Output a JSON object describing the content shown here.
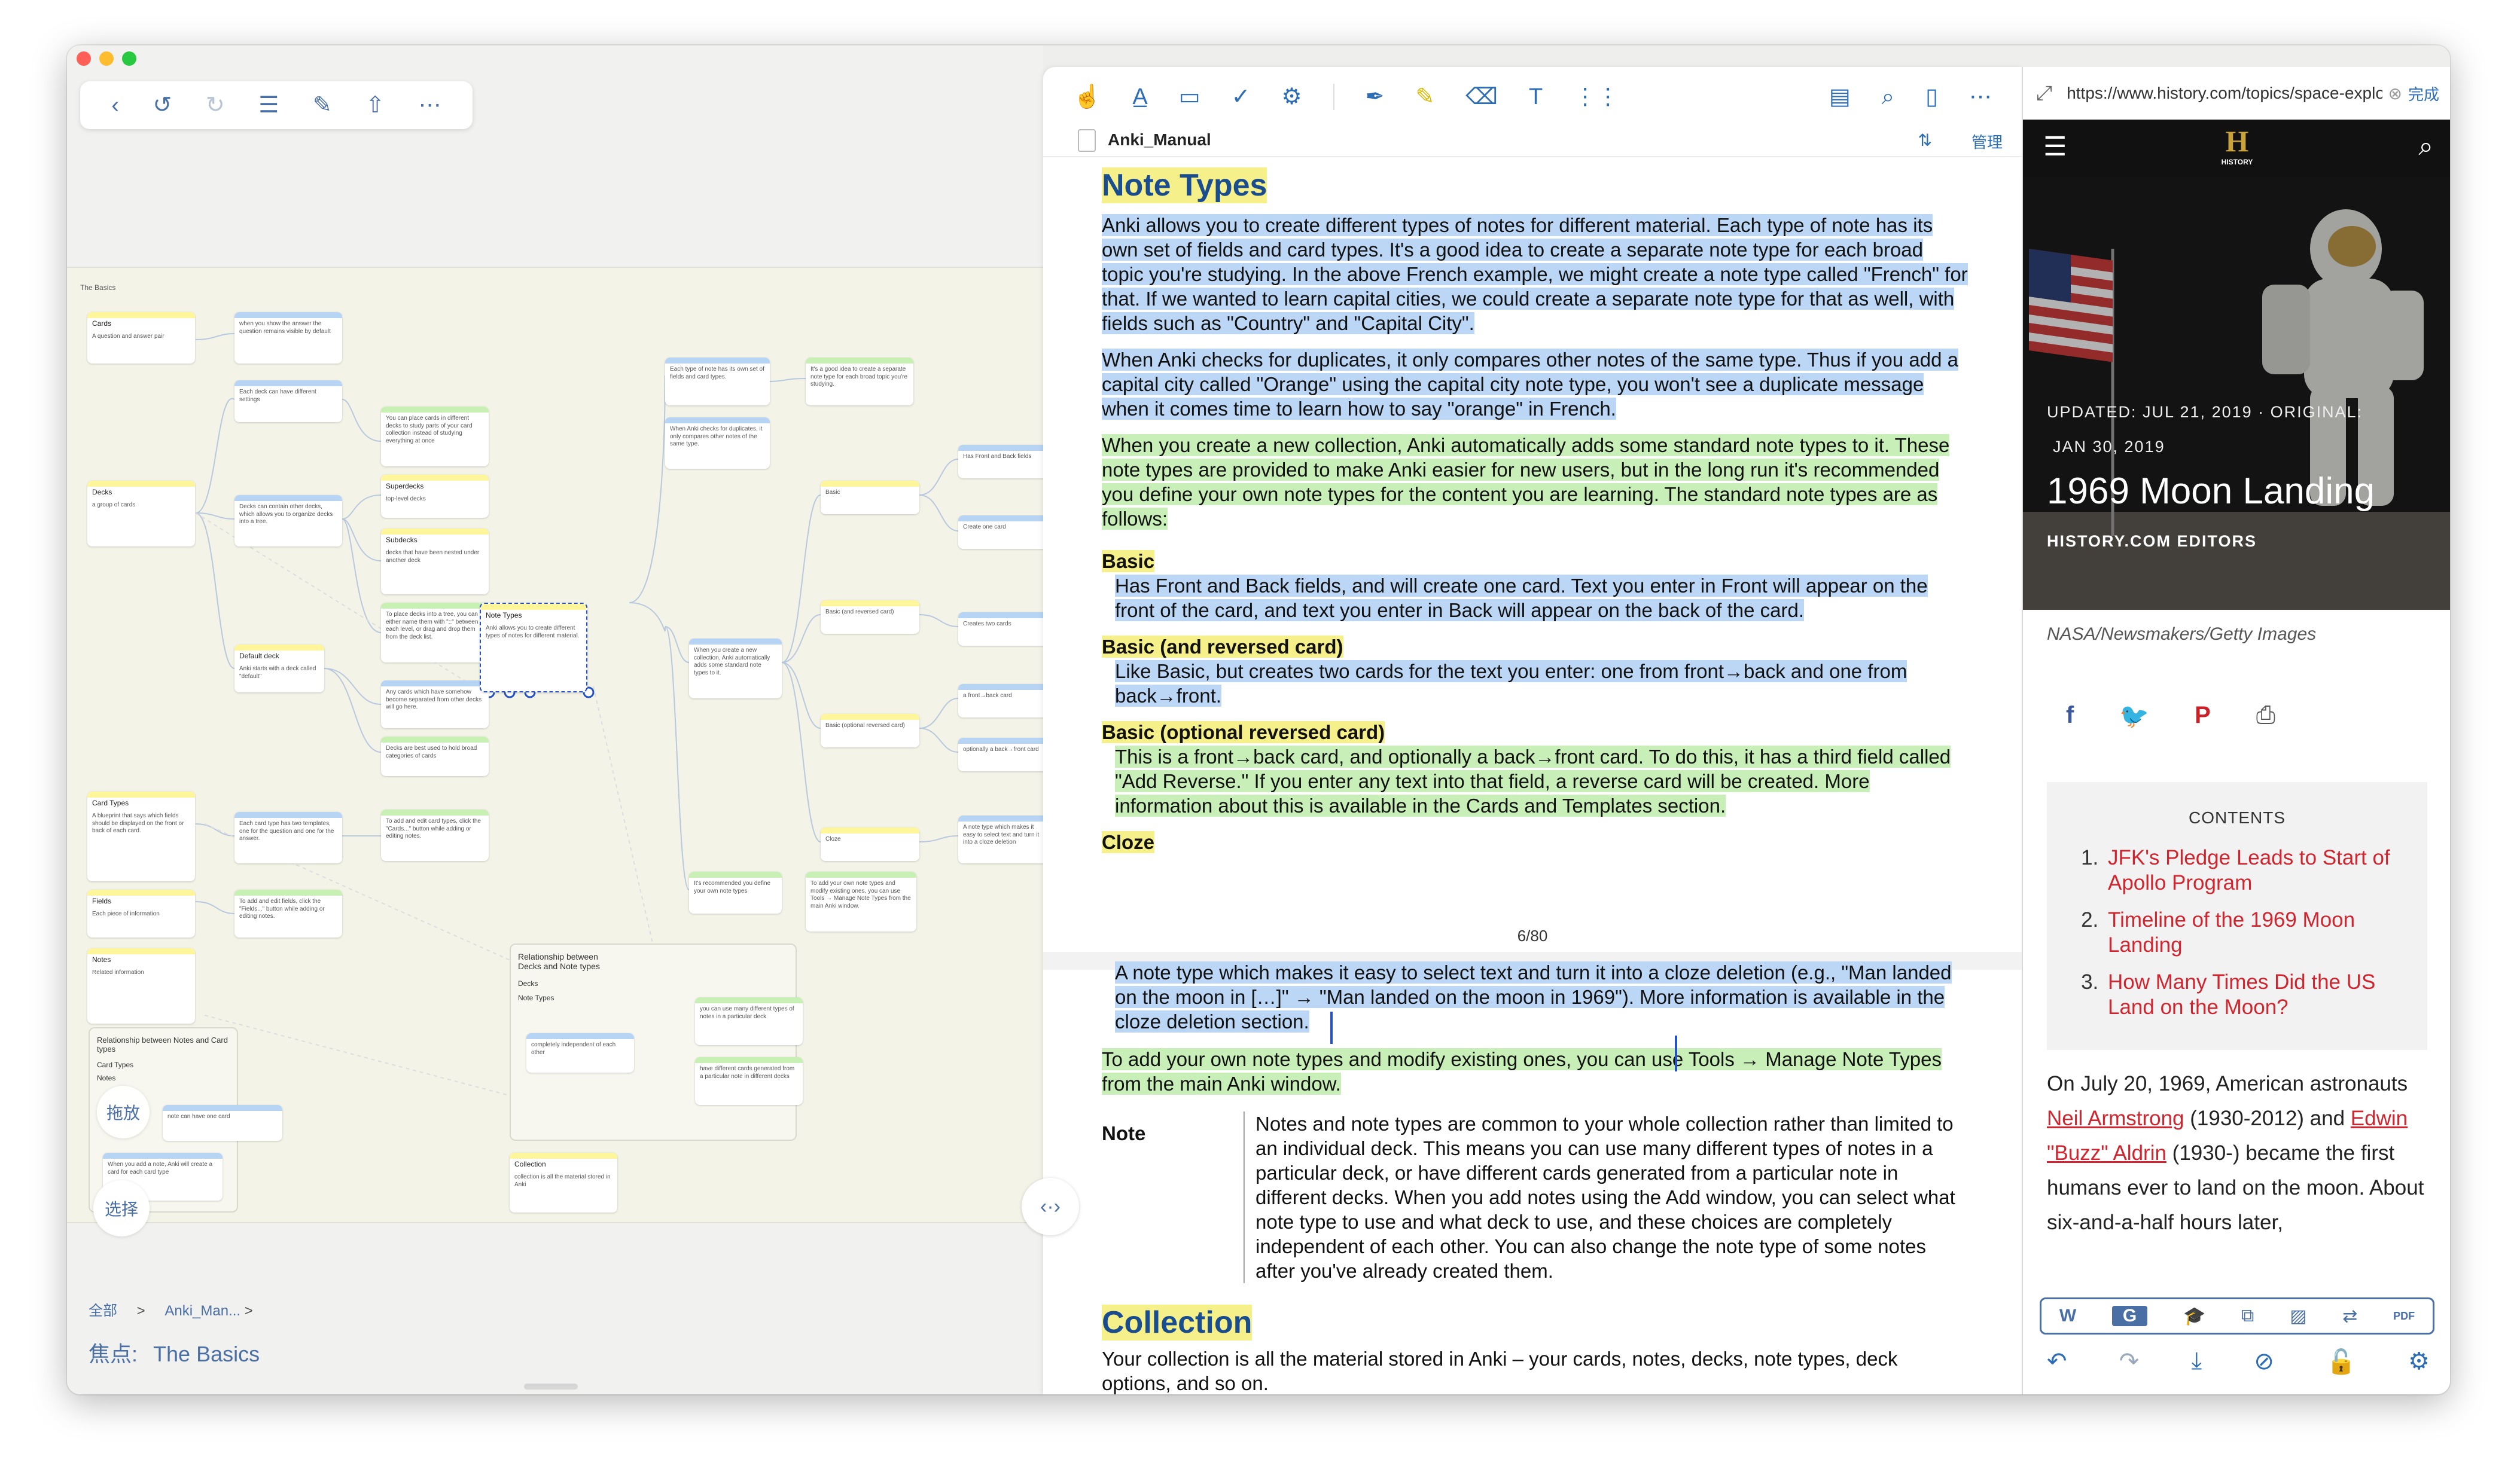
{
  "window": {
    "traffic": [
      "#ff5f57",
      "#febc2e",
      "#28c840"
    ]
  },
  "mindmap": {
    "toolbar": [
      "‹",
      "↺",
      "↻",
      "☰",
      "✎",
      "⇧",
      "⋯"
    ],
    "canvas_title": "The Basics",
    "nodes": [
      {
        "id": "cards",
        "title": "Cards",
        "text": "A question and answer pair"
      },
      {
        "id": "c1",
        "title": "",
        "text": "when you show the answer the question remains visible by default"
      },
      {
        "id": "c2",
        "title": "",
        "text": "Each deck can have different settings"
      },
      {
        "id": "c3",
        "title": "",
        "text": "You can place cards in different decks to study parts of your card collection instead of studying everything at once"
      },
      {
        "id": "superdecks",
        "title": "Superdecks",
        "text": "top-level decks"
      },
      {
        "id": "subdecks",
        "title": "Subdecks",
        "text": "decks that have been nested under another deck"
      },
      {
        "id": "decks",
        "title": "Decks",
        "text": "a group of cards"
      },
      {
        "id": "c4",
        "title": "",
        "text": "Decks can contain other decks, which allows you to organize decks into a tree."
      },
      {
        "id": "c5",
        "title": "",
        "text": "To place decks into a tree, you can either name them with \"::\" between each level, or drag and drop them from the deck list."
      },
      {
        "id": "defaultdeck",
        "title": "Default deck",
        "text": "Anki starts with a deck called \"default\""
      },
      {
        "id": "c6",
        "title": "",
        "text": "Any cards which have somehow become separated from other decks will go here."
      },
      {
        "id": "c7",
        "title": "",
        "text": "Decks are best used to hold broad categories of cards"
      },
      {
        "id": "notetypes",
        "title": "Note Types",
        "text": "Anki allows you to create different types of notes for different material."
      },
      {
        "id": "cardtypes",
        "title": "Card Types",
        "text": "A blueprint that says which fields should be displayed on the front or back of each card."
      },
      {
        "id": "c8",
        "title": "",
        "text": "Each card type has two templates, one for the question and one for the answer."
      },
      {
        "id": "c9",
        "title": "",
        "text": "To add and edit card types, click the \"Cards...\" button while adding or editing notes."
      },
      {
        "id": "fields",
        "title": "Fields",
        "text": "Each piece of information"
      },
      {
        "id": "c10",
        "title": "",
        "text": "To add and edit fields, click the \"Fields...\" button while adding or editing notes."
      },
      {
        "id": "notes",
        "title": "Notes",
        "text": "Related information"
      },
      {
        "id": "c11",
        "title": "",
        "text": "Each type of note has its own set of fields and card types."
      },
      {
        "id": "c12",
        "title": "",
        "text": "It's a good idea to create a separate note type for each broad topic you're studying."
      },
      {
        "id": "c13",
        "title": "",
        "text": "When Anki checks for duplicates, it only compares other notes of the same type."
      },
      {
        "id": "c14",
        "title": "",
        "text": "When you create a new collection, Anki automatically adds some standard note types to it."
      },
      {
        "id": "basic",
        "title": "",
        "text": "Basic"
      },
      {
        "id": "basicrev",
        "title": "",
        "text": "Basic (and reversed card)"
      },
      {
        "id": "basicopt",
        "title": "",
        "text": "Basic (optional reversed card)"
      },
      {
        "id": "cloze",
        "title": "",
        "text": "Cloze"
      },
      {
        "id": "c15",
        "title": "",
        "text": "Has Front and Back fields"
      },
      {
        "id": "c16",
        "title": "",
        "text": "Create one card"
      },
      {
        "id": "c17",
        "title": "",
        "text": "Creates two cards"
      },
      {
        "id": "c18",
        "title": "",
        "text": "a front→back card"
      },
      {
        "id": "c19",
        "title": "",
        "text": "optionally a back→front card"
      },
      {
        "id": "c20",
        "title": "",
        "text": "A note type which makes it easy to select text and turn it into a cloze deletion"
      },
      {
        "id": "c21",
        "title": "",
        "text": "It's recommended you define your own note types"
      },
      {
        "id": "c22",
        "title": "",
        "text": "To add your own note types and modify existing ones, you can use Tools → Manage Note Types from the main Anki window."
      },
      {
        "id": "c23",
        "title": "",
        "text": "you can use many different types of notes in a particular deck"
      },
      {
        "id": "c24",
        "title": "",
        "text": "completely independent of each other"
      },
      {
        "id": "c25",
        "title": "",
        "text": "have different cards generated from a particular note in different decks"
      },
      {
        "id": "collection",
        "title": "Collection",
        "text": "collection is all the material stored in Anki"
      },
      {
        "id": "c26",
        "title": "",
        "text": "note can have one card"
      },
      {
        "id": "c27",
        "title": "",
        "text": "When you add a note, Anki will create a card for each card type"
      }
    ],
    "rel1": {
      "title": "Relationship between Decks and Note types",
      "items": [
        "Decks",
        "Note Types"
      ]
    },
    "rel2": {
      "title": "Relationship between Notes and Card types",
      "items": [
        "Card Types",
        "Notes"
      ]
    },
    "drag_label": "拖放",
    "select_label": "选择",
    "breadcrumb": {
      "root": "全部",
      "sep": ">",
      "current": "Anki_Man..."
    },
    "focus_label": "焦点:",
    "focus_value": "The Basics"
  },
  "splitter_label": "‹·›",
  "pdf": {
    "toolbar": [
      "☝",
      "A̲",
      "▭",
      "✓",
      "⚙",
      "✒",
      "✎",
      "⌫",
      "T",
      "⋮⋮"
    ],
    "toolbar_right": [
      "▤",
      "⌕",
      "▯",
      "⋯"
    ],
    "doc_title": "Anki_Manual",
    "doc_sort_icon": "⇅",
    "manage_label": "管理",
    "page1": {
      "heading": "Note Types",
      "p1": "Anki allows you to create different types of notes for different material. Each type of note has its own set of fields and card types. It's a good idea to create a separate note type for each broad topic you're studying. In the above French example, we might create a note type called \"French\" for that. If we wanted to learn capital cities, we could create a separate note type for that as well, with fields such as \"Country\" and \"Capital City\".",
      "p2": "When Anki checks for duplicates, it only compares other notes of the same type. Thus if you add a capital city called \"Orange\" using the capital city note type, you won't see a duplicate message when it comes time to learn how to say \"orange\" in French.",
      "p3": "When you create a new collection, Anki automatically adds some standard note types to it. These note types are provided to make Anki easier for new users, but in the long run it's recommended you define your own note types for the content you are learning. The standard note types are as follows:",
      "basic_h": "Basic",
      "basic_t": "Has Front and Back fields, and will create one card. Text you enter in Front will appear on the front of the card, and text you enter in Back will appear on the back of the card.",
      "rev_h": "Basic (and reversed card)",
      "rev_t": "Like Basic, but creates two cards for the text you enter: one from front→back and one from back→front.",
      "opt_h": "Basic (optional reversed card)",
      "opt_t": "This is a front→back card, and optionally a back→front card. To do this, it has a third field called \"Add Reverse.\" If you enter any text into that field, a reverse card will be created. More information about this is available in the Cards and Templates section.",
      "cloze_h": "Cloze",
      "page_number": "6/80"
    },
    "page2": {
      "p1": "A note type which makes it easy to select text and turn it into a cloze deletion (e.g., \"Man landed on the moon in […]\" → \"Man landed on the moon in 1969\"). More information is available in the cloze deletion section.",
      "p2": "To add your own note types and modify existing ones, you can use Tools → Manage Note Types from the main Anki window.",
      "note_label": "Note",
      "note_text": "Notes and note types are common to your whole collection rather than limited to an individual deck. This means you can use many different types of notes in a particular deck, or have different cards generated from a particular note in different decks. When you add notes using the Add window, you can select what note type to use and what deck to use, and these choices are completely independent of each other. You can also change the note type of some notes after you've already created them.",
      "heading2": "Collection",
      "p3": "Your collection is all the material stored in Anki – your cards, notes, decks, note types, deck options, and so on."
    }
  },
  "web": {
    "expand_icon": "⤢",
    "url": "https://www.history.com/topics/space-exploration/moon-landing-1969",
    "clear_icon": "⊗",
    "done_label": "完成",
    "menu_icon": "☰",
    "logo_letter": "H",
    "logo_text": "HISTORY",
    "search_icon": "⌕",
    "hero_updated": "UPDATED: JUL 21, 2019 · ORIGINAL:",
    "hero_original": "JAN 30, 2019",
    "hero_title": "1969 Moon Landing",
    "hero_author": "HISTORY.COM EDITORS",
    "caption": "NASA/Newsmakers/Getty Images",
    "share": [
      {
        "name": "facebook",
        "glyph": "f",
        "color": "#3b5998"
      },
      {
        "name": "twitter",
        "glyph": "🐦",
        "color": "#1da1f2"
      },
      {
        "name": "pinterest",
        "glyph": "P",
        "color": "#cb2027"
      },
      {
        "name": "print",
        "glyph": "⎙",
        "color": "#555555"
      }
    ],
    "contents_title": "CONTENTS",
    "contents": [
      "JFK's Pledge Leads to Start of Apollo Program",
      "Timeline of the 1969 Moon Landing",
      "How Many Times Did the US Land on the Moon?"
    ],
    "article_1": "On July 20, 1969, American astronauts ",
    "link_1": "Neil Armstrong",
    "article_2": " (1930-2012) and ",
    "link_2": "Edwin \"Buzz\" Aldrin",
    "article_3": " (1930-) became the first humans ever to land on the moon. About six-and-a-half hours later,",
    "tools": [
      "W",
      "G",
      "🎓",
      "⧉",
      "▨",
      "⇄",
      "PDF"
    ],
    "nav": [
      "↶",
      "↷",
      "⤓",
      "⊘",
      "🔓",
      "⚙"
    ]
  }
}
